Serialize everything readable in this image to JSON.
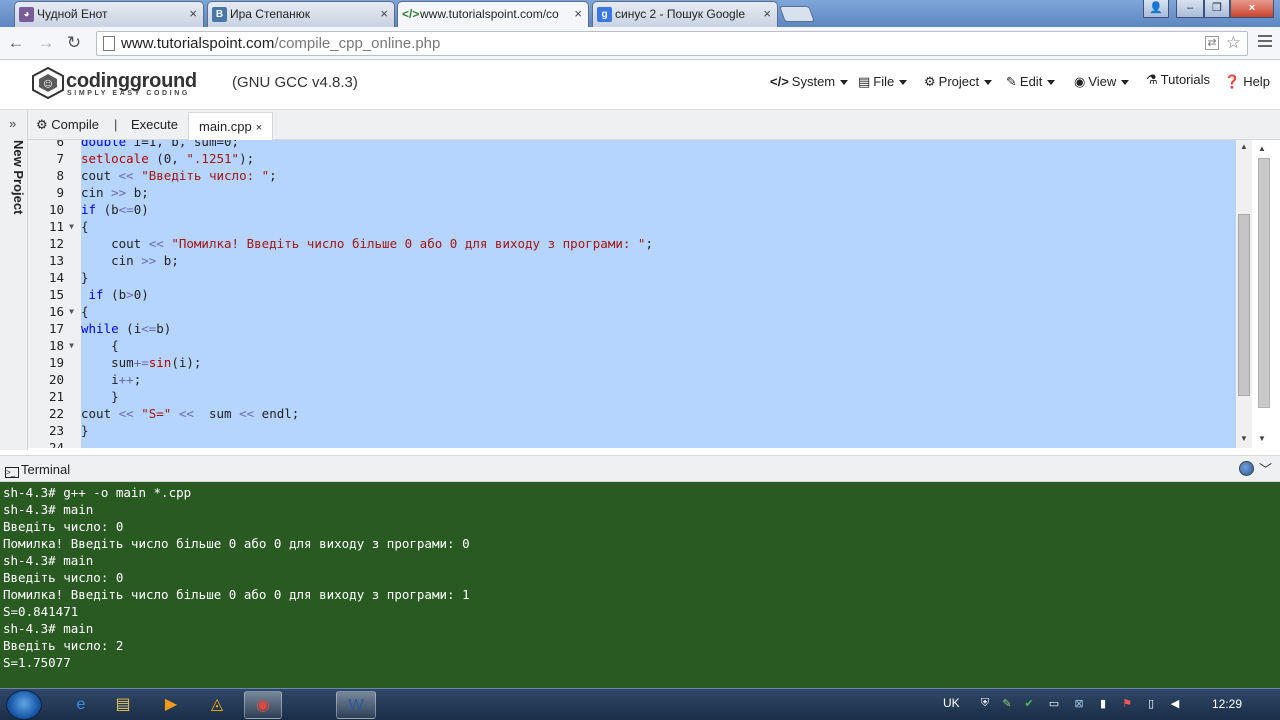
{
  "browser": {
    "tabs": [
      {
        "title": "Чудной Енот",
        "icon": "raccoon-icon",
        "color": "#7a5b9a"
      },
      {
        "title": "Ира Степанюк",
        "icon": "vk-icon",
        "color": "#4a76a8"
      },
      {
        "title": "www.tutorialspoint.com/co",
        "icon": "code-icon",
        "color": "#2e7d32",
        "active": true
      },
      {
        "title": "синус 2 - Пошук Google",
        "icon": "google-icon",
        "color": "#3b78e7"
      }
    ],
    "url_host": "www.tutorialspoint.com",
    "url_path": "/compile_cpp_online.php"
  },
  "app": {
    "brand": "codingground",
    "tagline": "SIMPLY EASY CODING",
    "compiler": "(GNU GCC v4.8.3)",
    "menu": [
      {
        "label": "System",
        "icon": "code-icon",
        "caret": true
      },
      {
        "label": "File",
        "icon": "file-icon",
        "caret": true
      },
      {
        "label": "Project",
        "icon": "gear-icon",
        "caret": true
      },
      {
        "label": "Edit",
        "icon": "edit-icon",
        "caret": true
      },
      {
        "label": "View",
        "icon": "eye-icon",
        "caret": true
      },
      {
        "label": "Tutorials",
        "icon": "tutorials-icon",
        "caret": false
      },
      {
        "label": "Help",
        "icon": "help-icon",
        "caret": false
      }
    ]
  },
  "sidebar": {
    "label": "New Project"
  },
  "editor": {
    "compile": "Compile",
    "separator": "|",
    "execute": "Execute",
    "file_tab": "main.cpp",
    "close": "×",
    "lines": [
      {
        "n": "6",
        "text": "double i=1, b, sum=0;"
      },
      {
        "n": "7",
        "text": "setlocale (0, \".1251\");"
      },
      {
        "n": "8",
        "text": "cout << \"Введіть число: \";"
      },
      {
        "n": "9",
        "text": "cin >> b;"
      },
      {
        "n": "10",
        "text": "if (b<=0)"
      },
      {
        "n": "11",
        "text": "{",
        "fold": true
      },
      {
        "n": "12",
        "text": "    cout << \"Помилка! Введіть число більше 0 або 0 для виходу з програми: \";"
      },
      {
        "n": "13",
        "text": "    cin >> b;"
      },
      {
        "n": "14",
        "text": "}"
      },
      {
        "n": "15",
        "text": " if (b>0)"
      },
      {
        "n": "16",
        "text": "{",
        "fold": true
      },
      {
        "n": "17",
        "text": "while (i<=b)"
      },
      {
        "n": "18",
        "text": "    {",
        "fold": true
      },
      {
        "n": "19",
        "text": "    sum+=sin(i);"
      },
      {
        "n": "20",
        "text": "    i++;"
      },
      {
        "n": "21",
        "text": "    }"
      },
      {
        "n": "22",
        "text": "cout << \"S=\" <<  sum << endl;"
      },
      {
        "n": "23",
        "text": "}"
      },
      {
        "n": "24",
        "text": ""
      }
    ]
  },
  "terminal": {
    "title": "Terminal",
    "lines": [
      "sh-4.3# g++ -o main *.cpp",
      "sh-4.3# main",
      "Введіть число: 0",
      "Помилка! Введіть число більше 0 або 0 для виходу з програми: 0",
      "sh-4.3# main",
      "Введіть число: 0",
      "Помилка! Введіть число більше 0 або 0 для виходу з програми: 1",
      "S=0.841471",
      "sh-4.3# main",
      "Введіть число: 2",
      "S=1.75077"
    ]
  },
  "taskbar": {
    "apps": [
      {
        "name": "ie-icon",
        "glyph": "e",
        "color": "#3a8ee6"
      },
      {
        "name": "explorer-icon",
        "glyph": "▤",
        "color": "#e8c25a"
      },
      {
        "name": "media-player-icon",
        "glyph": "▶",
        "color": "#f29a1c"
      },
      {
        "name": "avast-icon",
        "glyph": "◬",
        "color": "#f2a900"
      },
      {
        "name": "chrome-icon",
        "glyph": "◉",
        "color": "#e0493a",
        "running": true
      },
      {
        "name": "word-icon",
        "glyph": "W",
        "color": "#2b579a",
        "running": true
      }
    ],
    "lang": "UK",
    "time": "12:29"
  }
}
